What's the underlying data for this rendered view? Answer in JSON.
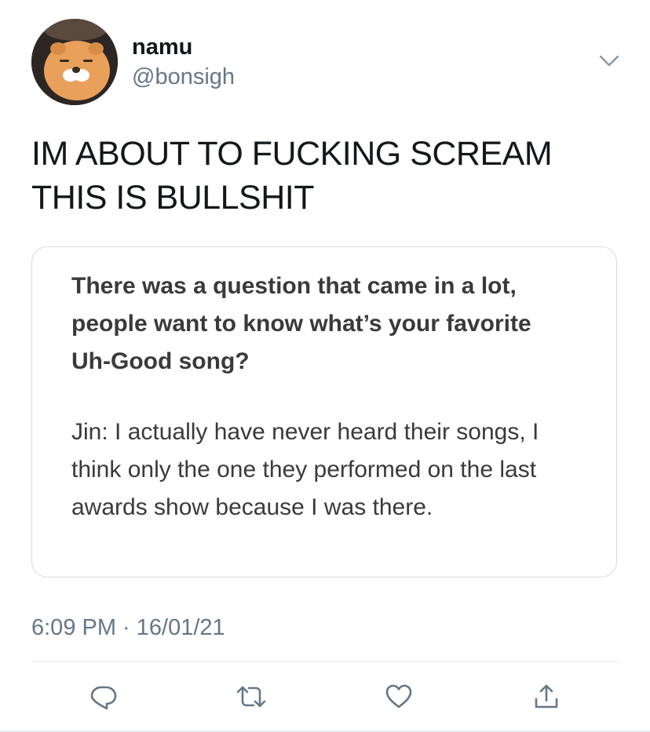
{
  "user": {
    "display_name": "namu",
    "handle": "@bonsigh",
    "avatar": "ryan-bear-plush-avatar"
  },
  "tweet": {
    "text": "IM ABOUT TO FUCKING SCREAM\nTHIS IS BULLSHIT",
    "timestamp": "6:09 PM · 16/01/21"
  },
  "attached_image": {
    "question": "There was a question that came in a lot, people want to know what’s your favorite Uh-Good song?",
    "answer": "Jin: I actually have never heard their songs, I think only the one they performed on the last awards show because I was there."
  },
  "actions": [
    {
      "icon": "reply-icon"
    },
    {
      "icon": "retweet-icon"
    },
    {
      "icon": "like-icon"
    },
    {
      "icon": "share-icon"
    }
  ],
  "colors": {
    "icon": "#657786",
    "text": "#14171a",
    "secondary": "#657786",
    "border": "#d5dbe0"
  }
}
